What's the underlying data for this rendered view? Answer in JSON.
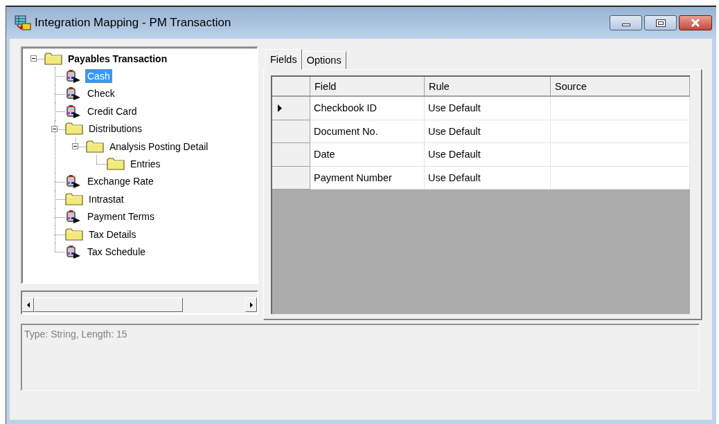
{
  "window": {
    "title": "Integration Mapping - PM Transaction"
  },
  "tree": {
    "items": [
      {
        "label": "Payables Transaction",
        "kind": "folder",
        "selected": false,
        "expanded": true,
        "children": [
          {
            "label": "Cash",
            "kind": "table",
            "selected": true
          },
          {
            "label": "Check",
            "kind": "table",
            "selected": false
          },
          {
            "label": "Credit Card",
            "kind": "table",
            "selected": false
          },
          {
            "label": "Distributions",
            "kind": "folder",
            "selected": false,
            "expanded": true,
            "children": [
              {
                "label": "Analysis Posting Detail",
                "kind": "folder",
                "selected": false,
                "expanded": true,
                "children": [
                  {
                    "label": "Entries",
                    "kind": "folder",
                    "selected": false
                  }
                ]
              }
            ]
          },
          {
            "label": "Exchange Rate",
            "kind": "table",
            "selected": false
          },
          {
            "label": "Intrastat",
            "kind": "folder",
            "selected": false
          },
          {
            "label": "Payment Terms",
            "kind": "table",
            "selected": false
          },
          {
            "label": "Tax Details",
            "kind": "folder",
            "selected": false
          },
          {
            "label": "Tax Schedule",
            "kind": "table",
            "selected": false
          }
        ]
      }
    ]
  },
  "tabs": [
    {
      "label": "Fields",
      "selected": true
    },
    {
      "label": "Options",
      "selected": false
    }
  ],
  "grid": {
    "columns": [
      "Field",
      "Rule",
      "Source"
    ],
    "rows": [
      {
        "selected": true,
        "cells": [
          "Checkbook ID",
          "Use Default"
        ]
      },
      {
        "selected": false,
        "cells": [
          "Document No.",
          "Use Default"
        ]
      },
      {
        "selected": false,
        "cells": [
          "Date",
          "Use Default"
        ]
      },
      {
        "selected": false,
        "cells": [
          "Payment Number",
          "Use Default"
        ]
      }
    ]
  },
  "description": "Type: String, Length: 15"
}
